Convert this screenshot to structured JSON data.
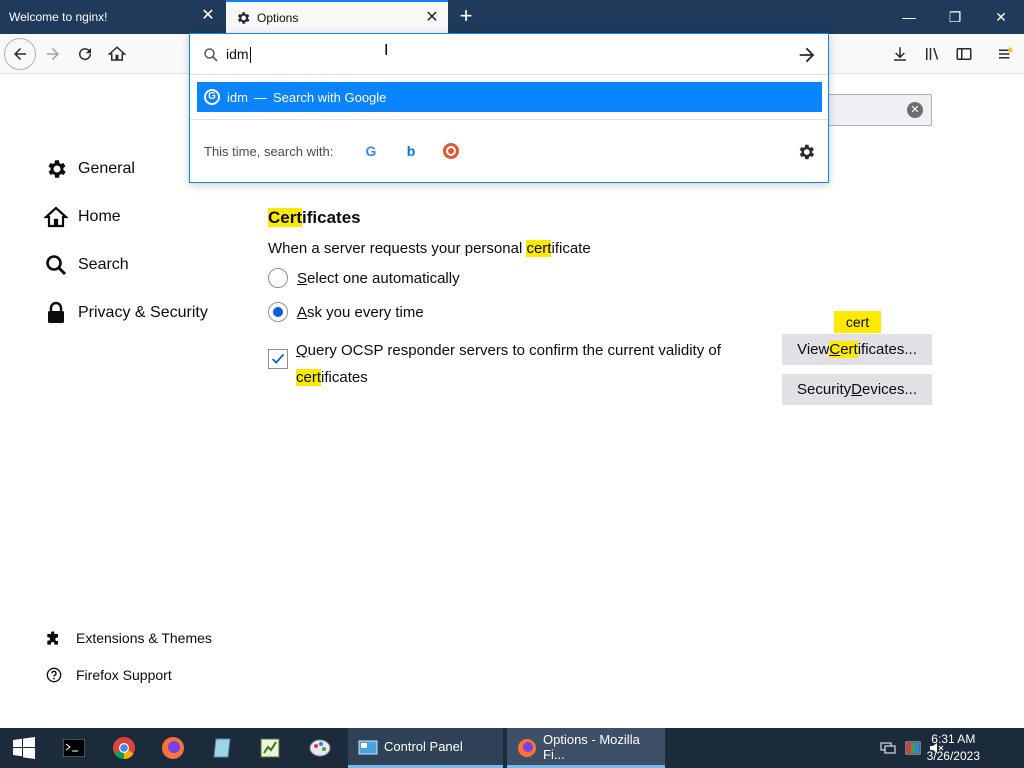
{
  "window": {
    "tabs": [
      {
        "label": "Welcome to nginx!",
        "active": false
      },
      {
        "label": "Options",
        "active": true
      }
    ],
    "controls": {
      "minimize": "—",
      "restore": "❐",
      "close": "✕"
    }
  },
  "urlbar": {
    "value": "idm",
    "result": {
      "query": "idm",
      "dash": "—",
      "action": "Search with Google"
    },
    "one_off_label": "This time, search with:",
    "engines": [
      {
        "name": "google-engine-icon",
        "glyph": "G",
        "color": "#4285f4"
      },
      {
        "name": "bing-engine-icon",
        "glyph": "b",
        "color": "#0078d4"
      },
      {
        "name": "duckduckgo-engine-icon",
        "glyph": "●",
        "color": "#de5833"
      }
    ]
  },
  "sidebar": {
    "categories": [
      {
        "label": "General",
        "icon": "gear-icon"
      },
      {
        "label": "Home",
        "icon": "home-icon"
      },
      {
        "label": "Search",
        "icon": "search-icon"
      },
      {
        "label": "Privacy & Security",
        "icon": "lock-icon"
      }
    ],
    "footer": [
      {
        "label": "Extensions & Themes",
        "icon": "puzzle-icon"
      },
      {
        "label": "Firefox Support",
        "icon": "help-icon"
      }
    ]
  },
  "certificates": {
    "title_hl": "Cert",
    "title_rest": "ificates",
    "desc_before": "When a server requests your personal ",
    "desc_hl": "cert",
    "desc_after": "ificate",
    "option_auto_accel": "S",
    "option_auto_rest": "elect one automatically",
    "option_ask_accel": "A",
    "option_ask_rest": "sk you every time",
    "selected": "ask",
    "ocsp_accel": "Q",
    "ocsp_text": "uery OCSP responder servers to confirm the current validity of ",
    "ocsp_hl": "cert",
    "ocsp_after": "ificates",
    "ocsp_checked": true,
    "view_before": "View ",
    "view_hl_accel": "C",
    "view_hl_rest": "ert",
    "view_after": "ificates...",
    "devices_before": "Security ",
    "devices_accel": "D",
    "devices_after": "evices...",
    "tooltip": "cert"
  },
  "taskbar": {
    "apps": [
      {
        "label": "Control Panel"
      },
      {
        "label": "Options - Mozilla Fi..."
      }
    ],
    "clock_time": "6:31 AM",
    "clock_date": "3/26/2023"
  },
  "colors": {
    "accent": "#0a84ff",
    "highlight": "#ffe900",
    "tabbar": "#1f3a5a",
    "taskbar": "#1c2b3c"
  }
}
